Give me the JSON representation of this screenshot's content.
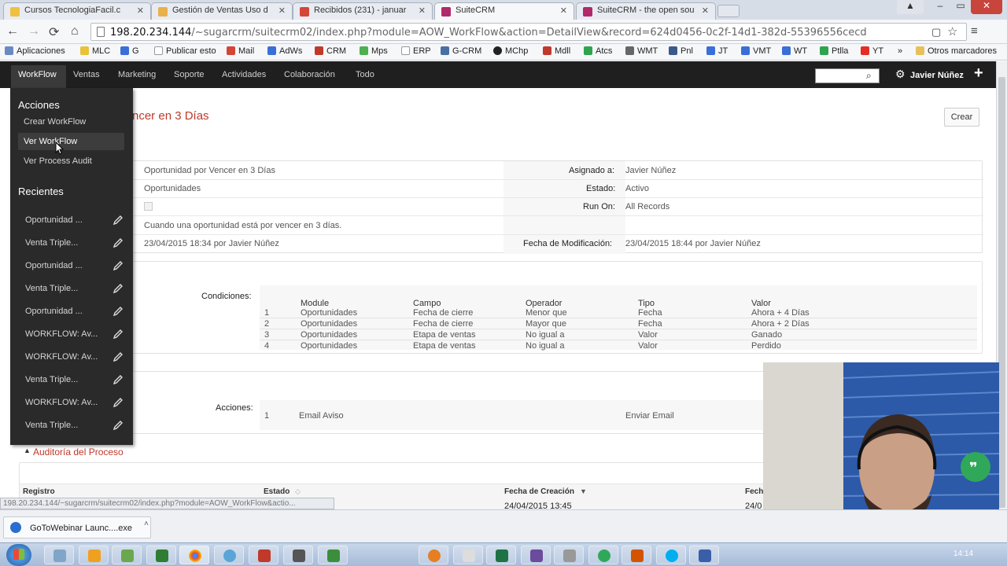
{
  "browser": {
    "tabs": [
      {
        "title": "Cursos TecnologiaFacil.c",
        "color": "#f0c040"
      },
      {
        "title": "Gestión de Ventas Uso d",
        "color": "#e8b14a"
      },
      {
        "title": "Recibidos (231) - januar",
        "color": "#d44638"
      },
      {
        "title": "SuiteCRM",
        "color": "#b1296a"
      },
      {
        "title": "SuiteCRM - the open sou",
        "color": "#b1296a"
      }
    ],
    "url_host": "198.20.234.144",
    "url_path": "/~sugarcrm/suitecrm02/index.php?module=AOW_WorkFlow&action=DetailView&record=624d0456-0c2f-14d1-382d-55396556cecd",
    "bookmarks": [
      "Aplicaciones",
      "MLC",
      "G",
      "Publicar esto",
      "Mail",
      "AdWs",
      "CRM",
      "Mps",
      "ERP",
      "G-CRM",
      "MChp",
      "Mdll",
      "Atcs",
      "WMT",
      "Pnl",
      "JT",
      "VMT",
      "WT",
      "Ptlla",
      "YT"
    ],
    "bookmark_more": "»",
    "other_bookmarks": "Otros marcadores"
  },
  "crm": {
    "nav": [
      "WorkFlow",
      "Ventas",
      "Marketing",
      "Soporte",
      "Actividades",
      "Colaboración",
      "Todo"
    ],
    "user": "Javier Núñez",
    "create_button": "Crear",
    "title_partial": "ncer en 3 Días",
    "detail": {
      "name_value": "Oportunidad por Vencer en 3 Días",
      "module_value": "Oportunidades",
      "description": "Cuando una oportunidad está por vencer en 3 días.",
      "created": "23/04/2015 18:34 por Javier Núñez",
      "assigned_label": "Asignado a:",
      "assigned_value": "Javier Núñez",
      "status_label": "Estado:",
      "status_value": "Activo",
      "runon_label": "Run On:",
      "runon_value": "All Records",
      "modified_label": "Fecha de Modificación:",
      "modified_value": "23/04/2015 18:44 por Javier Núñez"
    },
    "conditions": {
      "label": "Condiciones:",
      "headers": [
        "Module",
        "Campo",
        "Operador",
        "Tipo",
        "Valor"
      ],
      "rows": [
        [
          "1",
          "Oportunidades",
          "Fecha de cierre",
          "Menor que",
          "Fecha",
          "Ahora + 4 Días"
        ],
        [
          "2",
          "Oportunidades",
          "Fecha de cierre",
          "Mayor que",
          "Fecha",
          "Ahora + 2 Días"
        ],
        [
          "3",
          "Oportunidades",
          "Etapa de ventas",
          "No igual a",
          "Valor",
          "Ganado"
        ],
        [
          "4",
          "Oportunidades",
          "Etapa de ventas",
          "No igual a",
          "Valor",
          "Perdido"
        ]
      ]
    },
    "actions": {
      "label": "Acciones:",
      "row": [
        "1",
        "Email Aviso",
        "Enviar Email"
      ]
    },
    "audit": {
      "title": "Auditoría del Proceso",
      "headers": [
        "Registro",
        "Estado",
        "Fecha de Creación",
        "Fech"
      ],
      "row_date": "24/04/2015 13:45",
      "row_partial": "24/0"
    },
    "menu": {
      "acciones_title": "Acciones",
      "acciones": [
        "Crear WorkFlow",
        "Ver WorkFlow",
        "Ver Process Audit"
      ],
      "recientes_title": "Recientes",
      "recientes": [
        "Oportunidad ...",
        "Venta Triple...",
        "Oportunidad ...",
        "Venta Triple...",
        "Oportunidad ...",
        "WORKFLOW: Av...",
        "WORKFLOW: Av...",
        "Venta Triple...",
        "WORKFLOW: Av...",
        "Venta Triple..."
      ]
    }
  },
  "status_link": "198.20.234.144/~sugarcrm/suitecrm02/index.php?module=AOW_WorkFlow&actio...",
  "download": {
    "name": "GoToWebinar Launc....exe",
    "caret": "˄"
  },
  "clock": "14:14"
}
